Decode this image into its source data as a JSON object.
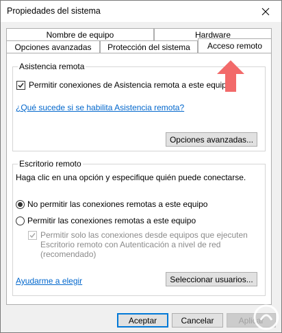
{
  "window": {
    "title": "Propiedades del sistema"
  },
  "tabs": {
    "row1": [
      "Nombre de equipo",
      "Hardware"
    ],
    "row2": [
      "Opciones avanzadas",
      "Protección del sistema",
      "Acceso remoto"
    ],
    "active": "Acceso remoto"
  },
  "remote_assistance": {
    "group_label": "Asistencia remota",
    "checkbox_label": "Permitir conexiones de Asistencia remota a este equipo",
    "checkbox_checked": true,
    "help_link": "¿Qué sucede si se habilita Asistencia remota?",
    "advanced_button": "Opciones avanzadas..."
  },
  "remote_desktop": {
    "group_label": "Escritorio remoto",
    "instruction": "Haga clic en una opción y especifique quién puede conectarse.",
    "options": [
      {
        "label": "No permitir las conexiones remotas a este equipo",
        "selected": true
      },
      {
        "label": "Permitir las conexiones remotas a este equipo",
        "selected": false
      }
    ],
    "nla_checkbox_lines": [
      "Permitir solo las conexiones desde equipos que ejecuten",
      "Escritorio remoto con Autenticación a nivel de red",
      "(recomendado)"
    ],
    "nla_checked": true,
    "nla_enabled": false,
    "help_link": "Ayudarme a elegir",
    "select_users_button": "Seleccionar usuarios..."
  },
  "footer": {
    "ok": "Aceptar",
    "cancel": "Cancelar",
    "apply": "Aplicar"
  },
  "colors": {
    "link": "#0066cc",
    "accent": "#0078d7",
    "arrow": "#f26a6a"
  }
}
